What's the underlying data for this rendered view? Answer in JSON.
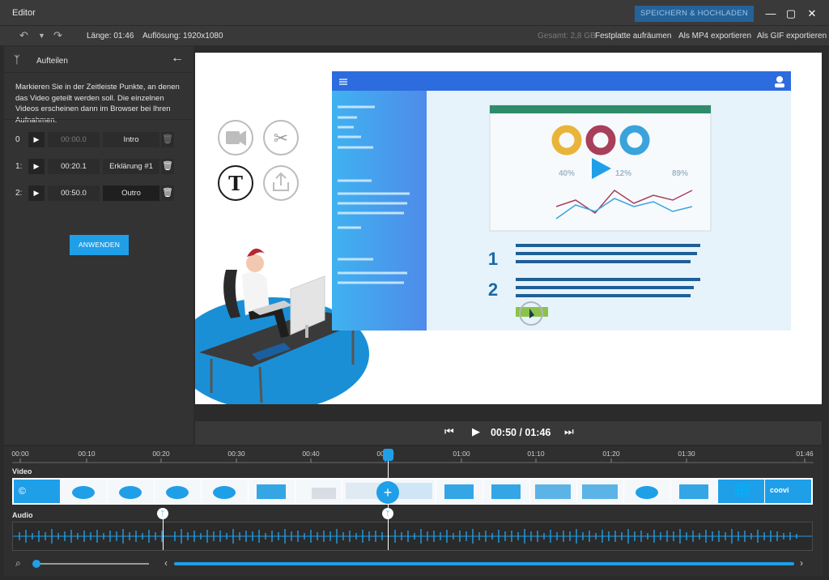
{
  "window": {
    "title": "Editor",
    "save_label": "SPEICHERN & HOCHLADEN"
  },
  "toolbar": {
    "length": "Länge: 01:46",
    "resolution": "Auflösung: 1920x1080",
    "total": "Gesamt: 2,8 GB",
    "cleanup": "Festplatte aufräumen",
    "export_mp4": "Als MP4 exportieren",
    "export_gif": "Als GIF exportieren"
  },
  "panel": {
    "title": "Aufteilen",
    "description": "Markieren Sie in der Zeitleiste Punkte, an denen das Video geteilt werden soll. Die einzelnen Videos erscheinen dann im Browser bei Ihren Aufnahmen.",
    "segments": [
      {
        "index": "0",
        "time": "00:00.0",
        "name": "Intro"
      },
      {
        "index": "1:",
        "time": "00:20.1",
        "name": "Erklärung #1"
      },
      {
        "index": "2:",
        "time": "00:50.0",
        "name": "Outro"
      }
    ],
    "apply_label": "ANWENDEN"
  },
  "preview": {
    "num1": "1",
    "num2": "2",
    "stats": [
      "40%",
      "12%",
      "89%"
    ]
  },
  "player": {
    "time": "00:50 / 01:46"
  },
  "timeline": {
    "ticks": [
      "00:00",
      "00:10",
      "00:20",
      "00:30",
      "00:40",
      "00:50",
      "01:00",
      "01:10",
      "01:20",
      "01:30",
      "01:46"
    ],
    "video_label": "Video",
    "audio_label": "Audio",
    "brand": "coovi"
  },
  "colors": {
    "accent": "#1f9fe8",
    "save_button": "#25629a",
    "panel_bg": "#333333"
  }
}
